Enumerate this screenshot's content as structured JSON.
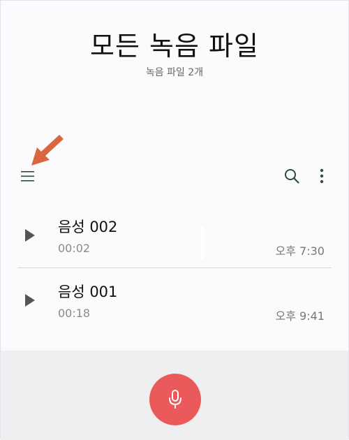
{
  "header": {
    "title": "모든 녹음 파일",
    "subtitle": "녹음 파일 2개"
  },
  "toolbar": {
    "menu_icon": "menu-icon",
    "search_icon": "search-icon",
    "more_icon": "more-vert-icon"
  },
  "annotation": {
    "arrow_icon": "arrow-pointer-icon",
    "color": "#d9663f"
  },
  "recordings": [
    {
      "name": "음성 002",
      "duration": "00:02",
      "time": "오후 7:30"
    },
    {
      "name": "음성 001",
      "duration": "00:18",
      "time": "오후 9:41"
    }
  ],
  "record_button": {
    "icon": "mic-icon",
    "color": "#ea5a5a"
  }
}
